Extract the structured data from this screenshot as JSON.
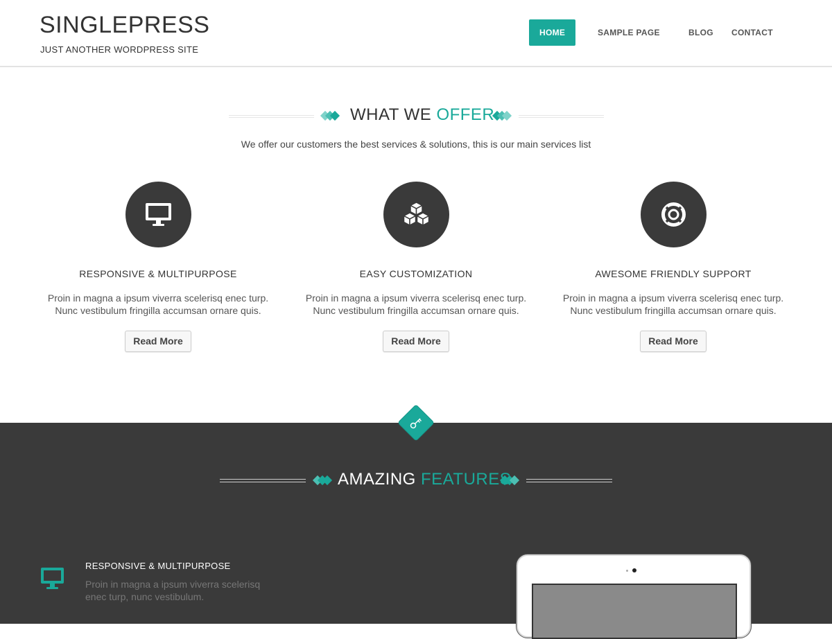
{
  "site": {
    "title": "SINGLEPRESS",
    "tagline": "JUST ANOTHER WORDPRESS SITE"
  },
  "nav": {
    "items": [
      {
        "label": "HOME",
        "active": true
      },
      {
        "label": "SAMPLE PAGE",
        "active": false
      },
      {
        "label": "BLOG",
        "active": false
      },
      {
        "label": "CONTACT",
        "active": false
      }
    ]
  },
  "colors": {
    "accent": "#1aa99a",
    "dark": "#3a3a3a"
  },
  "offer": {
    "title_main": "WHAT WE",
    "title_accent": "OFFER",
    "subtitle": "We offer our customers the best services & solutions, this is our main services list",
    "services": [
      {
        "icon": "monitor-icon",
        "title": "RESPONSIVE & MULTIPURPOSE",
        "text_line1": "Proin in magna a ipsum viverra scelerisq enec turp.",
        "text_line2": "Nunc vestibulum fringilla accumsan ornare quis.",
        "button": "Read More"
      },
      {
        "icon": "cubes-icon",
        "title": "EASY CUSTOMIZATION",
        "text_line1": "Proin in magna a ipsum viverra scelerisq enec turp.",
        "text_line2": "Nunc vestibulum fringilla accumsan ornare quis.",
        "button": "Read More"
      },
      {
        "icon": "life-ring-icon",
        "title": "AWESOME FRIENDLY SUPPORT",
        "text_line1": "Proin in magna a ipsum viverra scelerisq enec turp.",
        "text_line2": "Nunc vestibulum fringilla accumsan ornare quis.",
        "button": "Read More"
      }
    ]
  },
  "features": {
    "badge_icon": "key-icon",
    "title_main": "AMAZING",
    "title_accent": "FEATURES",
    "items": [
      {
        "icon": "monitor-icon",
        "title": "RESPONSIVE & MULTIPURPOSE",
        "text": "Proin in magna a ipsum viverra scelerisq enec turp, nunc vestibulum."
      }
    ]
  }
}
